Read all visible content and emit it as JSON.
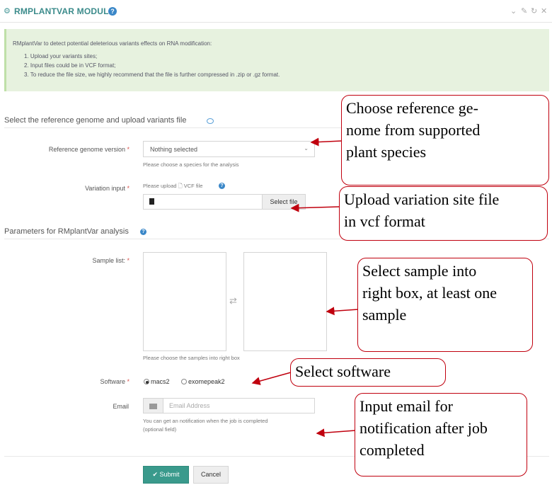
{
  "header": {
    "title": "RMPLANTVAR MODULE",
    "icons": [
      "cogs-icon",
      "help-icon",
      "collapse-icon",
      "pin-icon",
      "refresh-icon",
      "close-icon"
    ]
  },
  "info": {
    "intro": "RMplantVar to detect potential deleterious variants effects on RNA modification:",
    "items": [
      "1. Upload your variants sites;",
      "2. Input files could be in VCF format;",
      "3. To reduce the file size, we highly recommend that the file is further compressed in .zip or .gz format."
    ]
  },
  "section1": {
    "title": "Select the reference genome and upload variants file"
  },
  "form": {
    "genome": {
      "label": "Reference genome version",
      "required": "*",
      "value": "Nothing selected",
      "hint": "Please choose a species for the analysis"
    },
    "variation": {
      "label": "Variation input",
      "required": "*",
      "hint_prefix": "Please upload",
      "hint_suffix": "VCF file",
      "button": "Select file"
    }
  },
  "section2": {
    "title": "Parameters for RMplantVar analysis"
  },
  "params": {
    "samples": {
      "label": "Sample list:",
      "required": "*",
      "swap": "⇄",
      "hint": "Please choose the samples into right box"
    },
    "software": {
      "label": "Software",
      "required": "*",
      "options": [
        {
          "label": "macs2",
          "selected": true
        },
        {
          "label": "exomepeak2",
          "selected": false
        }
      ]
    },
    "email": {
      "label": "Email",
      "placeholder": "Email Address",
      "hint_line1": "You can get an notification when the job is completed",
      "hint_line2": "(optional field)"
    }
  },
  "actions": {
    "submit": "Submit",
    "cancel": "Cancel"
  },
  "annotations": {
    "genome": [
      "Choose reference ge-",
      "nome from supported",
      "plant species"
    ],
    "upload": [
      "Upload variation site file",
      "in vcf format"
    ],
    "samples": [
      "Select sample into",
      "right box, at least one",
      "sample"
    ],
    "software": [
      "Select software"
    ],
    "email": [
      "Input email for",
      "notification after job",
      "completed"
    ]
  },
  "colors": {
    "accent": "#3a9a8c",
    "info_bg": "#e7f2df",
    "annotation": "#c0000e"
  }
}
